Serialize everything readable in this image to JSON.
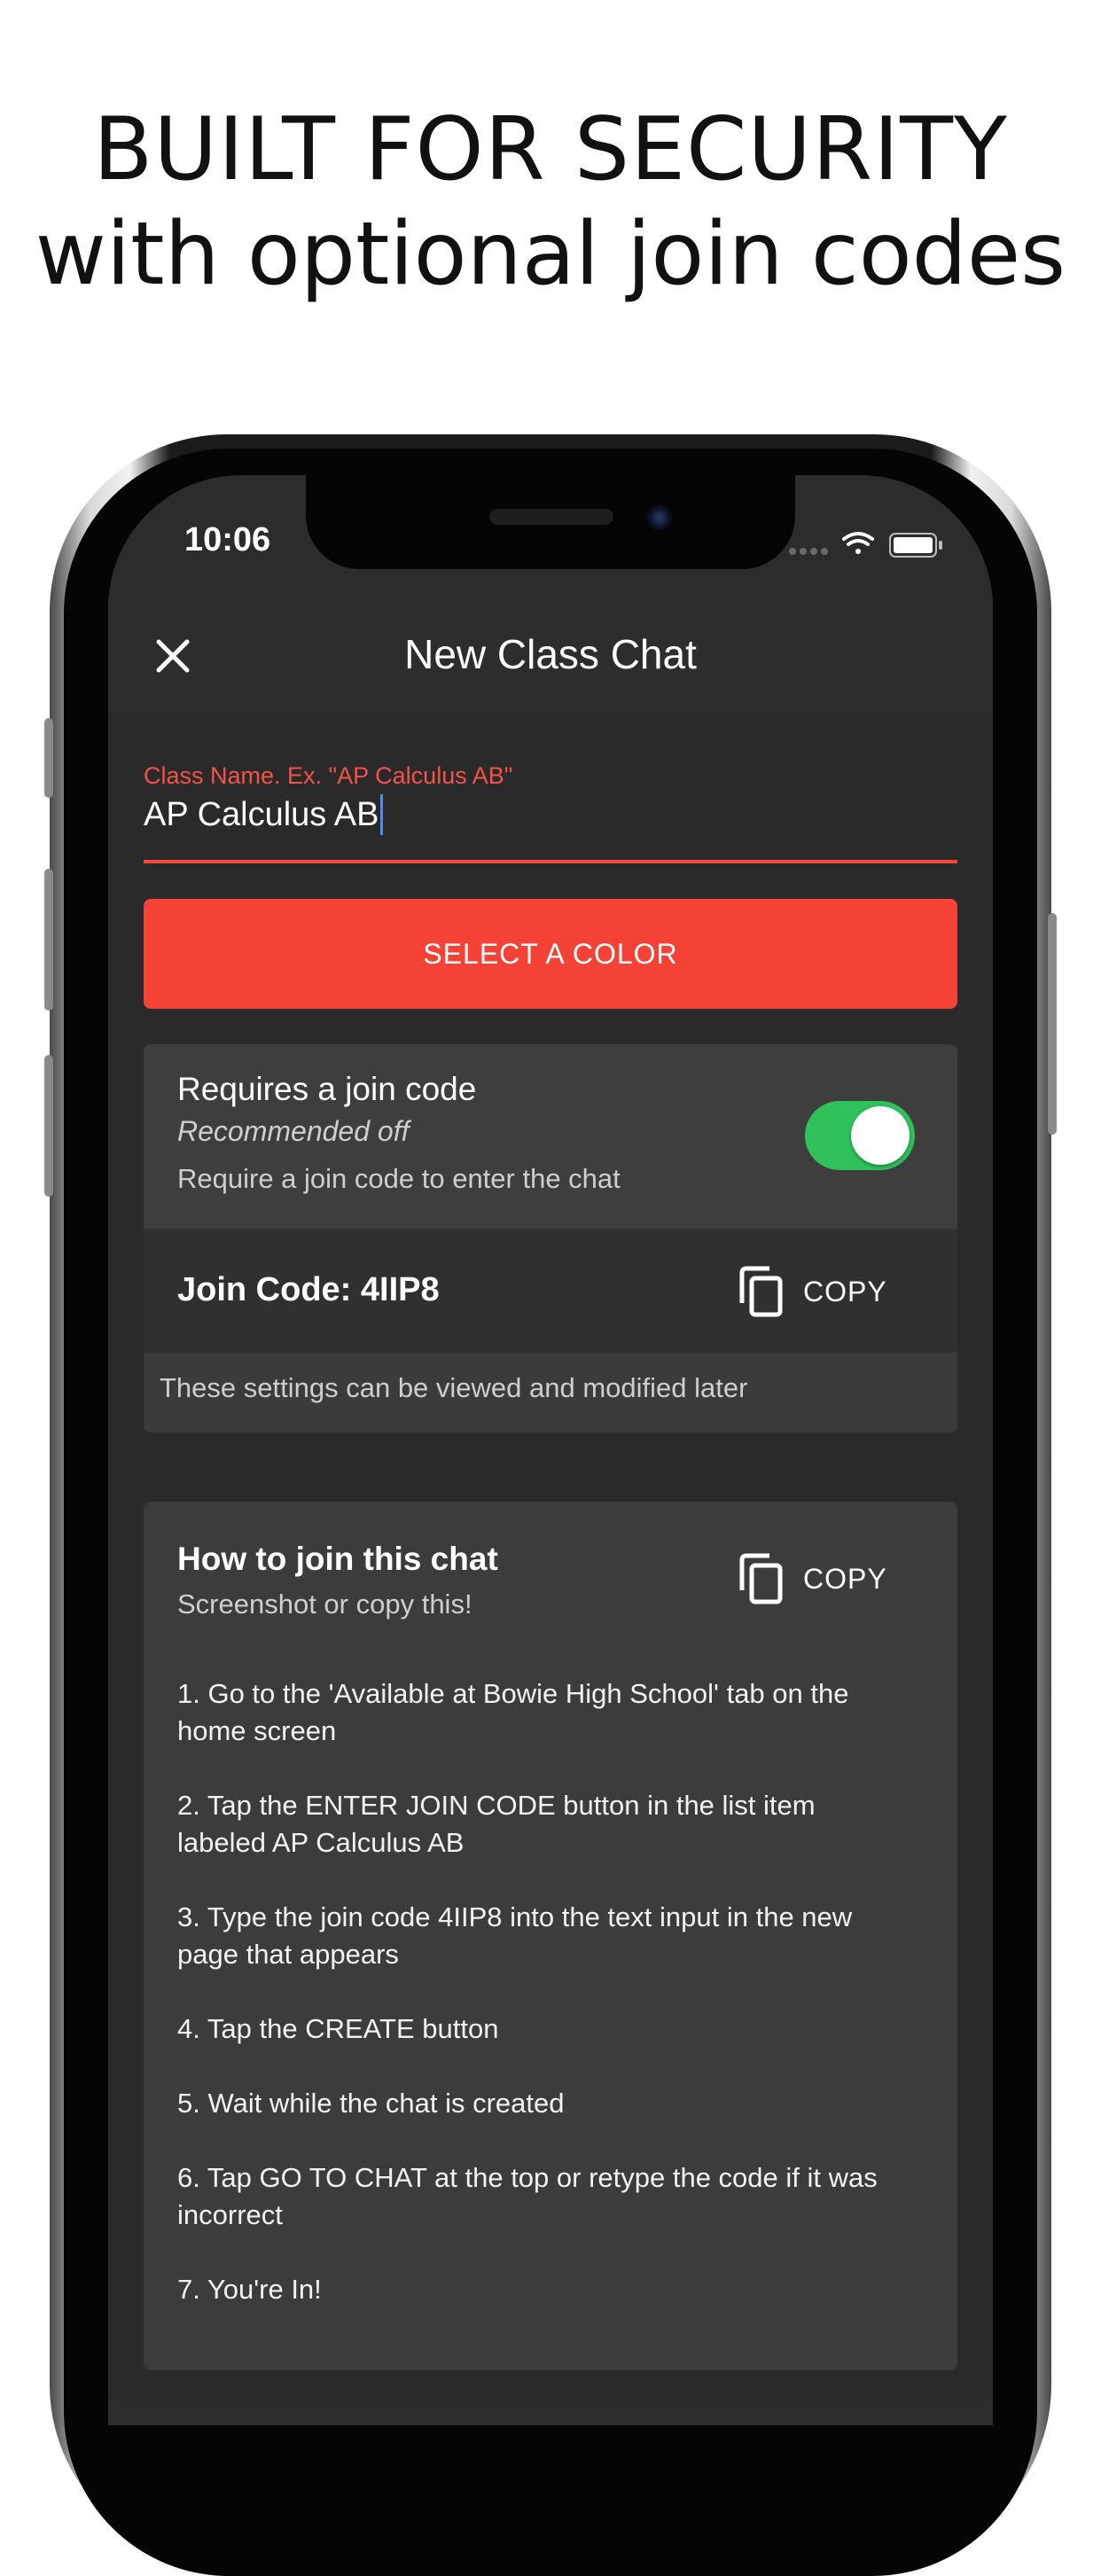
{
  "headline": {
    "line1": "BUILT FOR SECURITY",
    "line2": "with optional join codes"
  },
  "status_bar": {
    "time": "10:06"
  },
  "header": {
    "title": "New Class Chat"
  },
  "class_name_field": {
    "label": "Class Name. Ex. \"AP Calculus AB\"",
    "value": "AP Calculus AB"
  },
  "color_button": {
    "label": "SELECT A COLOR"
  },
  "join_code_settings": {
    "title": "Requires a join code",
    "subtitle": "Recommended off",
    "description": "Require a join code to enter the chat",
    "toggle_on": true,
    "code_label": "Join Code: 4IIP8",
    "copy_label": "COPY",
    "note": "These settings can be viewed and modified later"
  },
  "how_to_join": {
    "title": "How to join this chat",
    "subtitle": "Screenshot or copy this!",
    "copy_label": "COPY",
    "steps": [
      "1. Go to the 'Available at Bowie High School' tab on the home screen",
      "2. Tap the ENTER JOIN CODE button in the list item labeled AP Calculus AB",
      "3. Type the join code 4IIP8 into the text input in the new page that appears",
      "4. Tap the CREATE button",
      "5. Wait while the chat is created",
      "6. Tap GO TO CHAT at the top or retype the code if it was incorrect",
      "7. You're In!"
    ]
  },
  "colors": {
    "accent_red": "#f44336",
    "toggle_green": "#2fc25b",
    "background_dark": "#2a2a2a"
  }
}
